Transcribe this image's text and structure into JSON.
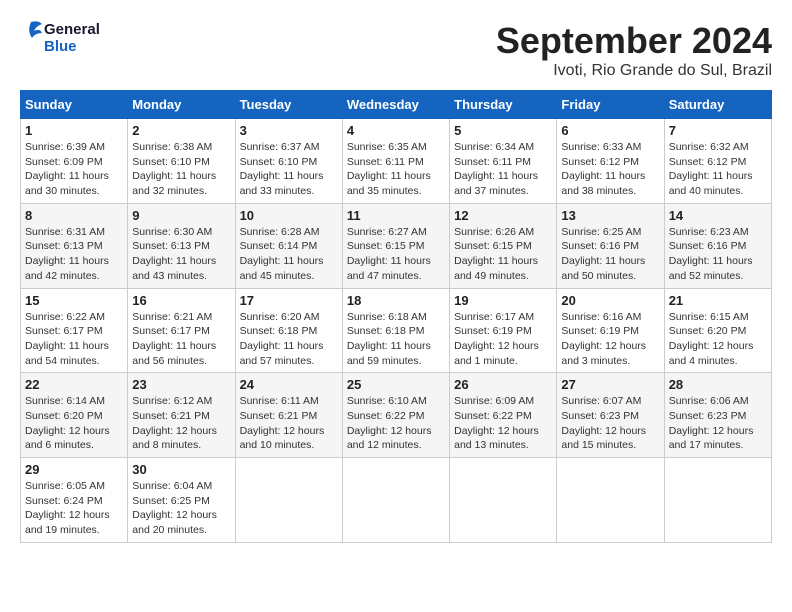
{
  "header": {
    "logo": {
      "line1": "General",
      "line2": "Blue"
    },
    "title": "September 2024",
    "location": "Ivoti, Rio Grande do Sul, Brazil"
  },
  "calendar": {
    "days_of_week": [
      "Sunday",
      "Monday",
      "Tuesday",
      "Wednesday",
      "Thursday",
      "Friday",
      "Saturday"
    ],
    "weeks": [
      [
        {
          "day": "1",
          "info": "Sunrise: 6:39 AM\nSunset: 6:09 PM\nDaylight: 11 hours\nand 30 minutes."
        },
        {
          "day": "2",
          "info": "Sunrise: 6:38 AM\nSunset: 6:10 PM\nDaylight: 11 hours\nand 32 minutes."
        },
        {
          "day": "3",
          "info": "Sunrise: 6:37 AM\nSunset: 6:10 PM\nDaylight: 11 hours\nand 33 minutes."
        },
        {
          "day": "4",
          "info": "Sunrise: 6:35 AM\nSunset: 6:11 PM\nDaylight: 11 hours\nand 35 minutes."
        },
        {
          "day": "5",
          "info": "Sunrise: 6:34 AM\nSunset: 6:11 PM\nDaylight: 11 hours\nand 37 minutes."
        },
        {
          "day": "6",
          "info": "Sunrise: 6:33 AM\nSunset: 6:12 PM\nDaylight: 11 hours\nand 38 minutes."
        },
        {
          "day": "7",
          "info": "Sunrise: 6:32 AM\nSunset: 6:12 PM\nDaylight: 11 hours\nand 40 minutes."
        }
      ],
      [
        {
          "day": "8",
          "info": "Sunrise: 6:31 AM\nSunset: 6:13 PM\nDaylight: 11 hours\nand 42 minutes."
        },
        {
          "day": "9",
          "info": "Sunrise: 6:30 AM\nSunset: 6:13 PM\nDaylight: 11 hours\nand 43 minutes."
        },
        {
          "day": "10",
          "info": "Sunrise: 6:28 AM\nSunset: 6:14 PM\nDaylight: 11 hours\nand 45 minutes."
        },
        {
          "day": "11",
          "info": "Sunrise: 6:27 AM\nSunset: 6:15 PM\nDaylight: 11 hours\nand 47 minutes."
        },
        {
          "day": "12",
          "info": "Sunrise: 6:26 AM\nSunset: 6:15 PM\nDaylight: 11 hours\nand 49 minutes."
        },
        {
          "day": "13",
          "info": "Sunrise: 6:25 AM\nSunset: 6:16 PM\nDaylight: 11 hours\nand 50 minutes."
        },
        {
          "day": "14",
          "info": "Sunrise: 6:23 AM\nSunset: 6:16 PM\nDaylight: 11 hours\nand 52 minutes."
        }
      ],
      [
        {
          "day": "15",
          "info": "Sunrise: 6:22 AM\nSunset: 6:17 PM\nDaylight: 11 hours\nand 54 minutes."
        },
        {
          "day": "16",
          "info": "Sunrise: 6:21 AM\nSunset: 6:17 PM\nDaylight: 11 hours\nand 56 minutes."
        },
        {
          "day": "17",
          "info": "Sunrise: 6:20 AM\nSunset: 6:18 PM\nDaylight: 11 hours\nand 57 minutes."
        },
        {
          "day": "18",
          "info": "Sunrise: 6:18 AM\nSunset: 6:18 PM\nDaylight: 11 hours\nand 59 minutes."
        },
        {
          "day": "19",
          "info": "Sunrise: 6:17 AM\nSunset: 6:19 PM\nDaylight: 12 hours\nand 1 minute."
        },
        {
          "day": "20",
          "info": "Sunrise: 6:16 AM\nSunset: 6:19 PM\nDaylight: 12 hours\nand 3 minutes."
        },
        {
          "day": "21",
          "info": "Sunrise: 6:15 AM\nSunset: 6:20 PM\nDaylight: 12 hours\nand 4 minutes."
        }
      ],
      [
        {
          "day": "22",
          "info": "Sunrise: 6:14 AM\nSunset: 6:20 PM\nDaylight: 12 hours\nand 6 minutes."
        },
        {
          "day": "23",
          "info": "Sunrise: 6:12 AM\nSunset: 6:21 PM\nDaylight: 12 hours\nand 8 minutes."
        },
        {
          "day": "24",
          "info": "Sunrise: 6:11 AM\nSunset: 6:21 PM\nDaylight: 12 hours\nand 10 minutes."
        },
        {
          "day": "25",
          "info": "Sunrise: 6:10 AM\nSunset: 6:22 PM\nDaylight: 12 hours\nand 12 minutes."
        },
        {
          "day": "26",
          "info": "Sunrise: 6:09 AM\nSunset: 6:22 PM\nDaylight: 12 hours\nand 13 minutes."
        },
        {
          "day": "27",
          "info": "Sunrise: 6:07 AM\nSunset: 6:23 PM\nDaylight: 12 hours\nand 15 minutes."
        },
        {
          "day": "28",
          "info": "Sunrise: 6:06 AM\nSunset: 6:23 PM\nDaylight: 12 hours\nand 17 minutes."
        }
      ],
      [
        {
          "day": "29",
          "info": "Sunrise: 6:05 AM\nSunset: 6:24 PM\nDaylight: 12 hours\nand 19 minutes."
        },
        {
          "day": "30",
          "info": "Sunrise: 6:04 AM\nSunset: 6:25 PM\nDaylight: 12 hours\nand 20 minutes."
        },
        {
          "day": "",
          "info": ""
        },
        {
          "day": "",
          "info": ""
        },
        {
          "day": "",
          "info": ""
        },
        {
          "day": "",
          "info": ""
        },
        {
          "day": "",
          "info": ""
        }
      ]
    ]
  }
}
